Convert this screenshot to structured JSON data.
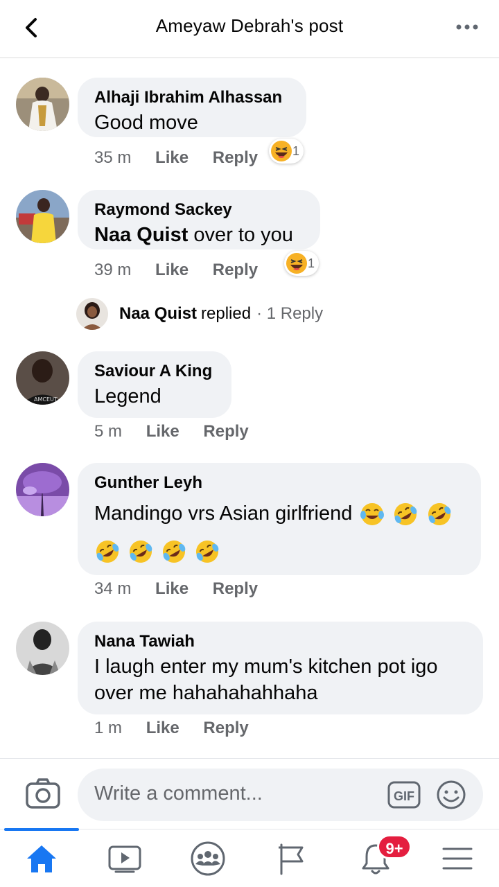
{
  "header": {
    "title": "Ameyaw Debrah's post"
  },
  "comments": [
    {
      "author": "Alhaji Ibrahim Alhassan",
      "text": "Good move",
      "time": "35 m",
      "like": "Like",
      "reply": "Reply",
      "reaction_count": "1"
    },
    {
      "author": "Raymond Sackey",
      "mention": "Naa Quist",
      "text": " over to you",
      "time": "39 m",
      "like": "Like",
      "reply": "Reply",
      "reaction_count": "1",
      "replies": {
        "author": "Naa Quist",
        "action": "replied",
        "count": "· 1 Reply"
      }
    },
    {
      "author": "Saviour A King",
      "text": "Legend",
      "time": "5 m",
      "like": "Like",
      "reply": "Reply"
    },
    {
      "author": "Gunther Leyh",
      "text": "Mandingo vrs Asian girlfriend",
      "time": "34 m",
      "like": "Like",
      "reply": "Reply"
    },
    {
      "author": "Nana Tawiah",
      "text_line1": "I laugh enter my mum's kitchen pot igo",
      "text_line2": "over me hahahahahhaha",
      "time": "1 m",
      "like": "Like",
      "reply": "Reply"
    }
  ],
  "composer": {
    "placeholder": "Write a comment...",
    "gif_label": "GIF"
  },
  "nav": {
    "notifications_badge": "9+"
  },
  "colors": {
    "accent": "#1877f2",
    "bubble": "#f0f2f5",
    "badge": "#e41e3f",
    "meta_text": "#65676b"
  }
}
